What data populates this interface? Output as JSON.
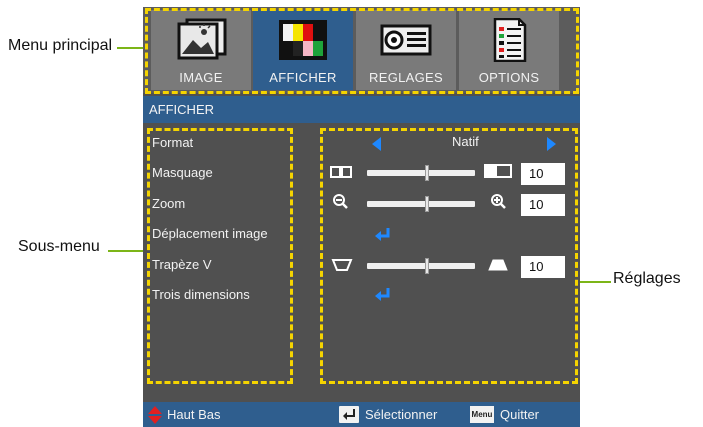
{
  "callouts": {
    "main_menu": "Menu principal",
    "submenu": "Sous-menu",
    "settings": "Réglages"
  },
  "tabs": [
    {
      "label": "IMAGE",
      "icon": "image-icon"
    },
    {
      "label": "AFFICHER",
      "icon": "display-color-bars-icon",
      "active": true
    },
    {
      "label": "REGLAGES",
      "icon": "projector-icon"
    },
    {
      "label": "OPTIONS",
      "icon": "options-list-icon"
    }
  ],
  "section_title": "AFFICHER",
  "menu_items": [
    "Format",
    "Masquage",
    "Zoom",
    "Déplacement image",
    "Trapèze V",
    "Trois dimensions"
  ],
  "settings": {
    "format_value": "Natif",
    "masquage_value": "10",
    "zoom_value": "10",
    "trapeze_value": "10"
  },
  "footer": {
    "updown_label": "Haut Bas",
    "select_label": "Sélectionner",
    "menu_key": "Menu",
    "quit_label": "Quitter"
  },
  "colors": {
    "active_blue": "#2f5e8e",
    "dash_yellow": "#f5d400",
    "arrow_blue": "#1e88ff",
    "leader_green": "#7cb518"
  }
}
